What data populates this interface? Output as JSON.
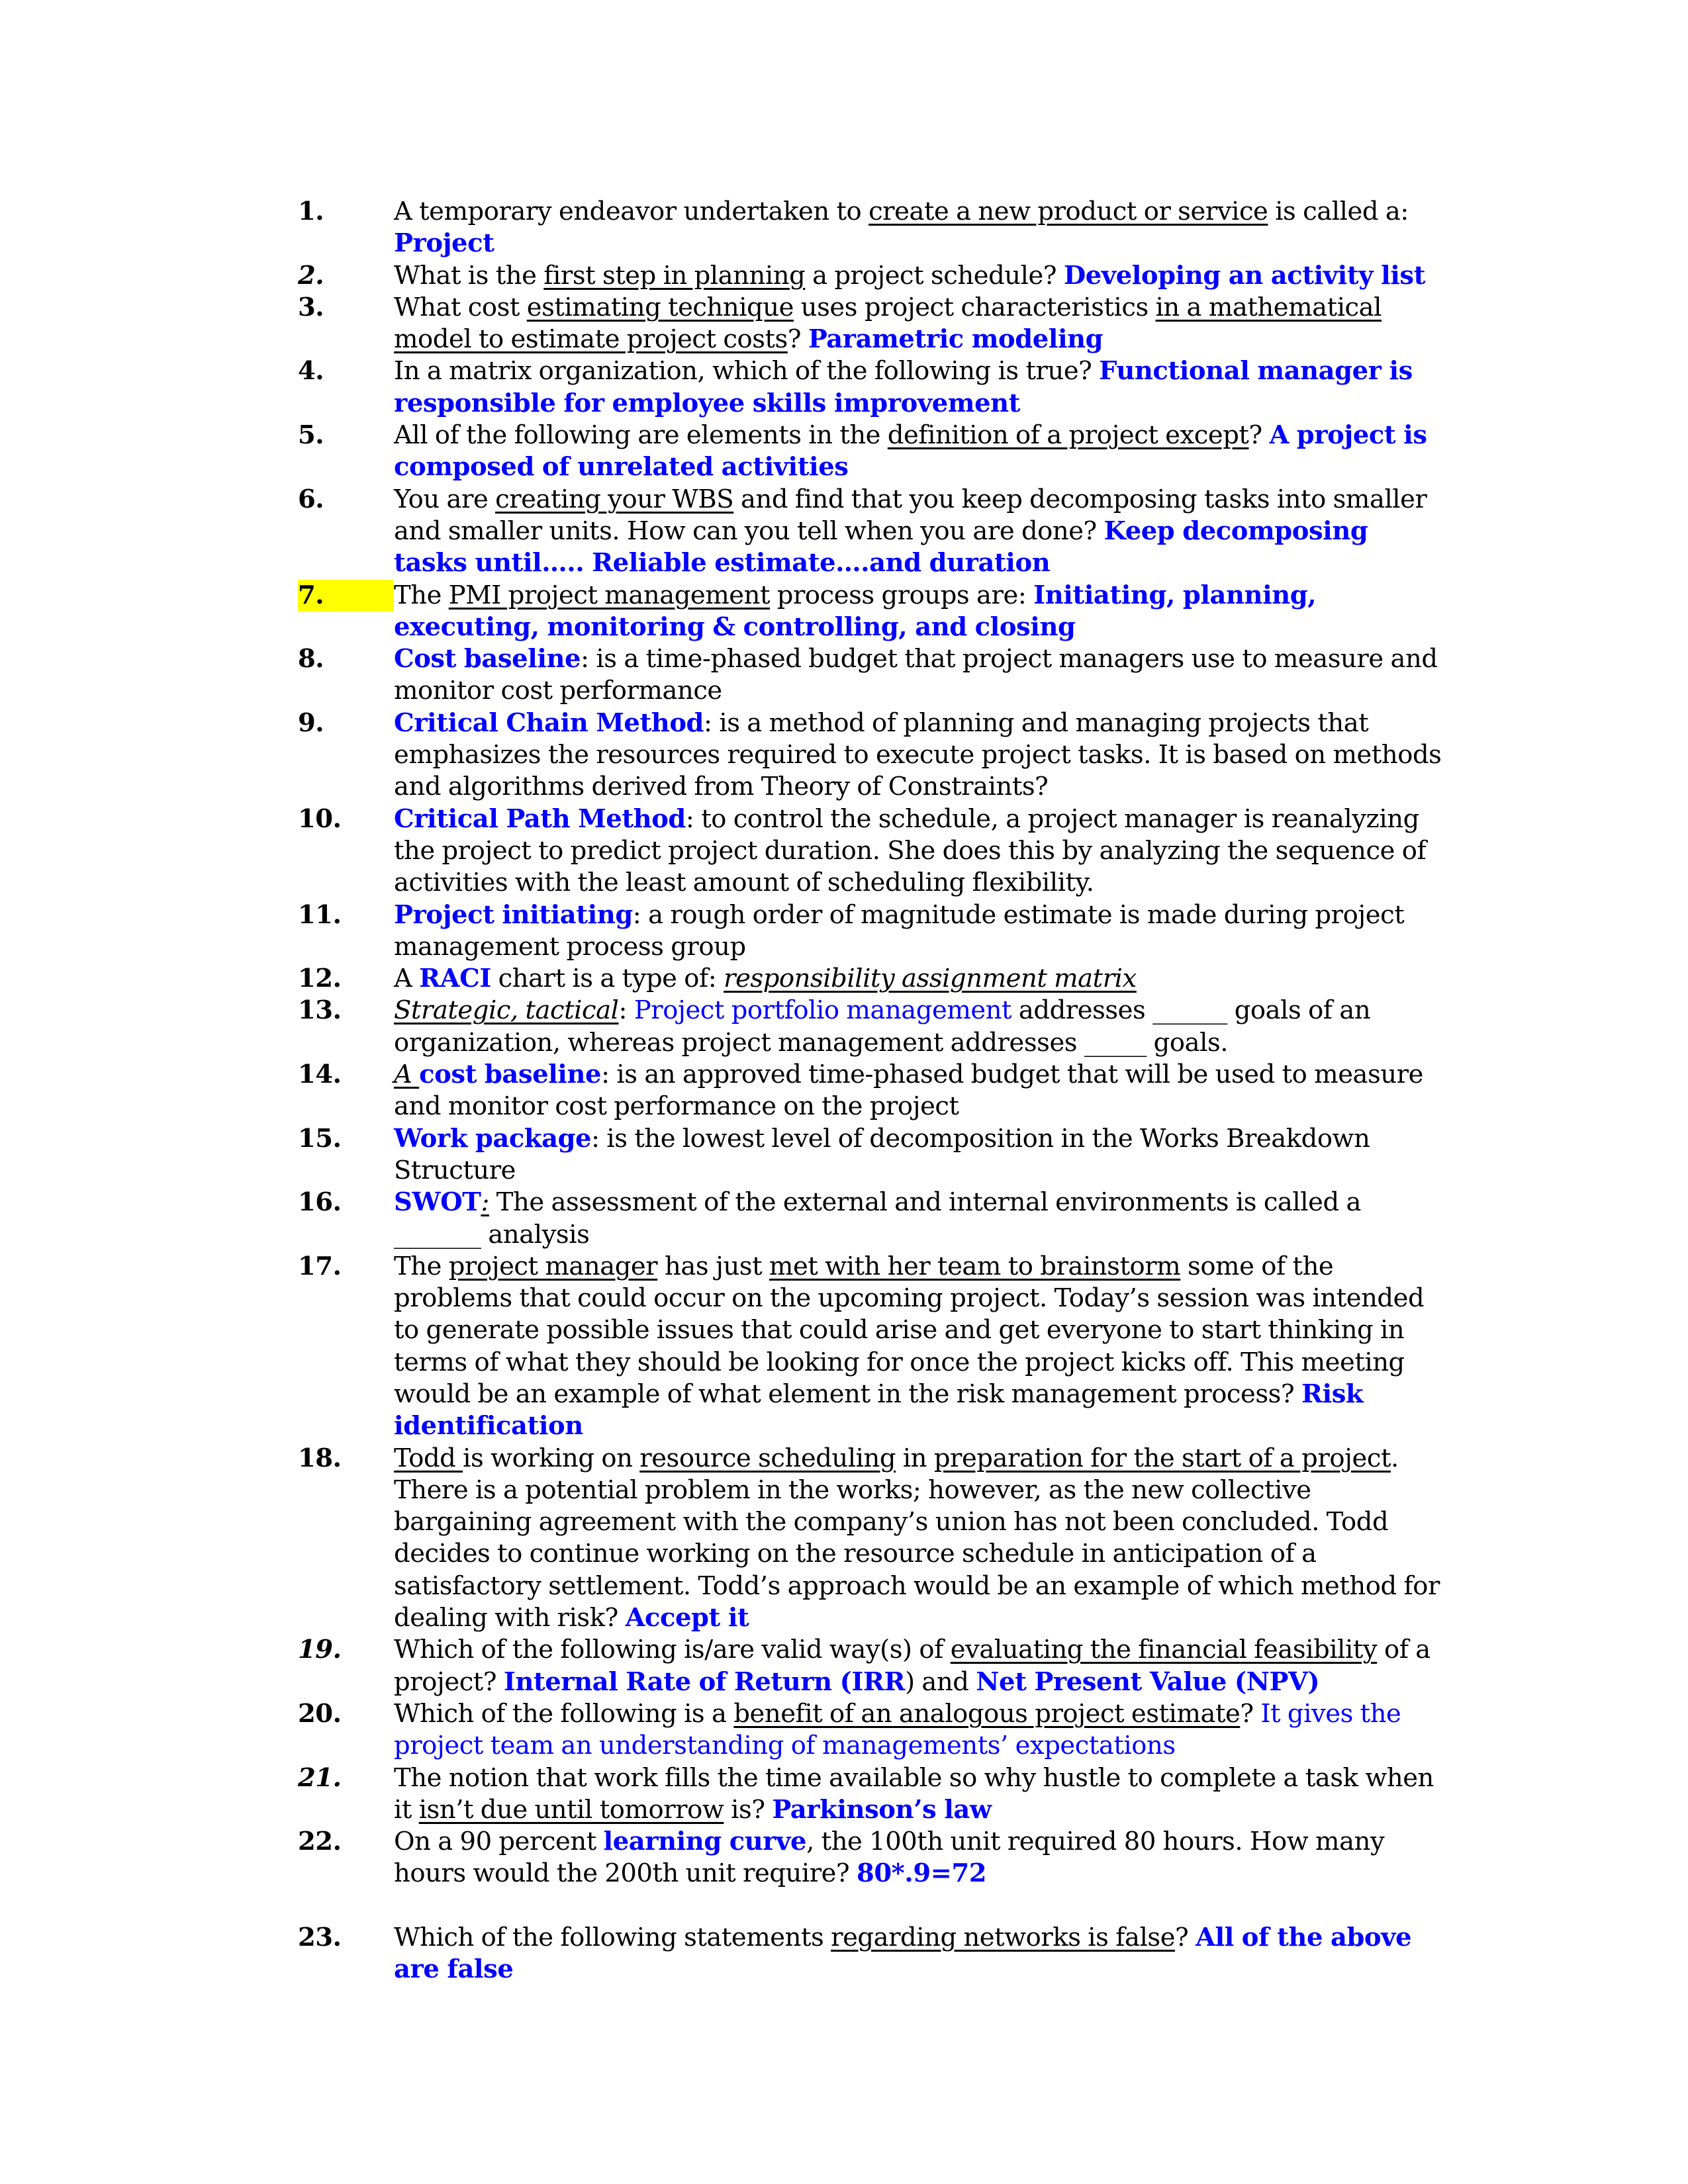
{
  "document": {
    "accent_color": "#0000ff",
    "highlight_color": "#ffff00",
    "questions": [
      {
        "number": "1.",
        "number_italic": false,
        "highlighted": false,
        "runs": [
          {
            "text": "A temporary endeavor undertaken to "
          },
          {
            "text": "create a new product or service",
            "u": true
          },
          {
            "text": " is called a: "
          },
          {
            "text": "Project",
            "b": true,
            "blue": true
          }
        ]
      },
      {
        "number": "2.",
        "number_italic": true,
        "highlighted": false,
        "runs": [
          {
            "text": "What is the "
          },
          {
            "text": "first step in planning",
            "u": true
          },
          {
            "text": " a project schedule? "
          },
          {
            "text": "Developing an activity list",
            "b": true,
            "blue": true
          }
        ]
      },
      {
        "number": "3.",
        "number_italic": false,
        "highlighted": false,
        "runs": [
          {
            "text": "What cost "
          },
          {
            "text": "estimating technique",
            "u": true
          },
          {
            "text": " uses project characteristics "
          },
          {
            "text": "in a mathematical model to estimate project costs",
            "u": true
          },
          {
            "text": "? "
          },
          {
            "text": "Parametric modeling",
            "b": true,
            "blue": true
          }
        ]
      },
      {
        "number": "4.",
        "number_italic": false,
        "highlighted": false,
        "runs": [
          {
            "text": "In a matrix organization, which of the following is true?  "
          },
          {
            "text": "Functional manager is responsible for employee skills improvement",
            "b": true,
            "blue": true
          }
        ]
      },
      {
        "number": "5.",
        "number_italic": false,
        "highlighted": false,
        "runs": [
          {
            "text": "All of the following are elements in the "
          },
          {
            "text": "definition of a project except",
            "u": true
          },
          {
            "text": "? "
          },
          {
            "text": "A project is composed of unrelated activities",
            "b": true,
            "blue": true
          }
        ]
      },
      {
        "number": "6.",
        "number_italic": false,
        "highlighted": false,
        "runs": [
          {
            "text": "You are "
          },
          {
            "text": "creating your WBS",
            "u": true
          },
          {
            "text": " and find that you keep decomposing tasks into smaller and smaller units. How can you tell when you are done? "
          },
          {
            "text": "Keep decomposing tasks until….. Reliable estimate….and duration",
            "b": true,
            "blue": true
          }
        ]
      },
      {
        "number": "7.",
        "number_italic": false,
        "highlighted": true,
        "runs": [
          {
            "text": "The "
          },
          {
            "text": "PMI project management",
            "u": true
          },
          {
            "text": " process groups are: "
          },
          {
            "text": "Initiating, planning, executing, monitoring & controlling, and closing",
            "b": true,
            "blue": true
          }
        ]
      },
      {
        "number": "8.",
        "number_italic": false,
        "highlighted": false,
        "runs": [
          {
            "text": "Cost baseline",
            "b": true,
            "blue": true
          },
          {
            "text": ": is a time-phased budget that project managers use to measure and monitor cost performance"
          }
        ]
      },
      {
        "number": "9.",
        "number_italic": false,
        "highlighted": false,
        "runs": [
          {
            "text": "Critical Chain Method",
            "b": true,
            "blue": true
          },
          {
            "text": ": is a method of planning and managing projects that emphasizes the resources required to execute project tasks. It is based on methods and algorithms derived from Theory of Constraints?"
          }
        ]
      },
      {
        "number": "10.",
        "number_italic": false,
        "highlighted": false,
        "runs": [
          {
            "text": "Critical Path Method",
            "b": true,
            "blue": true
          },
          {
            "text": ": to control the schedule, a project manager is reanalyzing the project to predict project duration. She does this by analyzing the sequence of activities with the least amount of scheduling flexibility."
          }
        ]
      },
      {
        "number": "11.",
        "number_italic": false,
        "highlighted": false,
        "runs": [
          {
            "text": "Project initiating",
            "b": true,
            "blue": true
          },
          {
            "text": ": a rough order of magnitude estimate is made during project management process group"
          }
        ]
      },
      {
        "number": "12.",
        "number_italic": false,
        "highlighted": false,
        "runs": [
          {
            "text": "A "
          },
          {
            "text": "RACI",
            "b": true,
            "blue": true
          },
          {
            "text": " chart is a type of: "
          },
          {
            "text": "responsibility assignment matrix",
            "i": true,
            "u": true
          }
        ]
      },
      {
        "number": "13.",
        "number_italic": false,
        "highlighted": false,
        "runs": [
          {
            "text": "Strategic, tactical",
            "i": true,
            "u": true
          },
          {
            "text": ": "
          },
          {
            "text": "Project portfolio management",
            "blue": true
          },
          {
            "text": " addresses ______ goals of an organization, whereas project management addresses _____ goals."
          }
        ]
      },
      {
        "number": "14.",
        "number_italic": false,
        "highlighted": false,
        "runs": [
          {
            "text": "A ",
            "i": true,
            "u": true
          },
          {
            "text": "cost baseline",
            "b": true,
            "blue": true
          },
          {
            "text": ": is an approved time-phased budget that will be used to measure and monitor cost performance on the project"
          }
        ]
      },
      {
        "number": "15.",
        "number_italic": false,
        "highlighted": false,
        "runs": [
          {
            "text": "Work package",
            "b": true,
            "blue": true
          },
          {
            "text": ": is the lowest level of decomposition in the Works Breakdown Structure"
          }
        ]
      },
      {
        "number": "16.",
        "number_italic": false,
        "highlighted": false,
        "runs": [
          {
            "text": "SWOT",
            "b": true,
            "blue": true
          },
          {
            "text": ":",
            "i": true,
            "u": true
          },
          {
            "text": " The assessment of the external and internal environments is called a _______ analysis"
          }
        ]
      },
      {
        "number": "17.",
        "number_italic": false,
        "highlighted": false,
        "runs": [
          {
            "text": "The "
          },
          {
            "text": "project manager",
            "u": true
          },
          {
            "text": " has just "
          },
          {
            "text": "met with her team to brainstorm",
            "u": true
          },
          {
            "text": " some of the problems that could occur on the upcoming project. Today’s session was intended to generate possible issues that could arise and get everyone to start thinking in terms of what they should be looking for once the project kicks off. This meeting would be an example of what element in the risk management process?  "
          },
          {
            "text": "Risk identification",
            "b": true,
            "blue": true
          }
        ]
      },
      {
        "number": "18.",
        "number_italic": false,
        "highlighted": false,
        "runs": [
          {
            "text": "Todd ",
            "u": true
          },
          {
            "text": "is working on "
          },
          {
            "text": "resource scheduling",
            "u": true
          },
          {
            "text": " in "
          },
          {
            "text": "preparation for the start of a project",
            "u": true
          },
          {
            "text": ". There is a potential problem in the works; however, as the new collective bargaining agreement with the company’s union has not been concluded. Todd decides to continue working on the resource schedule in anticipation of a satisfactory settlement. Todd’s approach would be an example of which method for dealing with risk? "
          },
          {
            "text": "Accept it",
            "b": true,
            "blue": true
          }
        ]
      },
      {
        "number": "19.",
        "number_italic": true,
        "highlighted": false,
        "runs": [
          {
            "text": "Which of the following is/are valid way(s) of "
          },
          {
            "text": "evaluating the financial feasibility",
            "u": true
          },
          {
            "text": " of a project?  "
          },
          {
            "text": "Internal Rate of Return (IRR",
            "b": true,
            "blue": true
          },
          {
            "text": ") and "
          },
          {
            "text": "Net Present Value (NPV)",
            "b": true,
            "blue": true
          }
        ]
      },
      {
        "number": "20.",
        "number_italic": false,
        "highlighted": false,
        "runs": [
          {
            "text": "Which of the following is a "
          },
          {
            "text": "benefit of an analogous project estimate",
            "u": true
          },
          {
            "text": "? "
          },
          {
            "text": "It gives the project team an understanding of managements’ expectations",
            "blue": true
          }
        ]
      },
      {
        "number": "21.",
        "number_italic": true,
        "highlighted": false,
        "runs": [
          {
            "text": "The notion that work fills the time available so why hustle to complete a task when it "
          },
          {
            "text": "isn’t due until tomorrow",
            "u": true
          },
          {
            "text": " is? "
          },
          {
            "text": "Parkinson’s law",
            "b": true,
            "blue": true
          }
        ]
      },
      {
        "number": "22.",
        "number_italic": false,
        "highlighted": false,
        "runs": [
          {
            "text": "On a 90 percent "
          },
          {
            "text": "learning curve",
            "b": true,
            "blue": true
          },
          {
            "text": ", the 100th unit required 80 hours. How many hours would the 200th unit require? "
          },
          {
            "text": "80*.9=72",
            "b": true,
            "blue": true
          }
        ]
      },
      {
        "number": "23.",
        "number_italic": false,
        "highlighted": false,
        "gap_before": true,
        "runs": [
          {
            "text": "Which of the following statements "
          },
          {
            "text": "regarding networks is false",
            "u": true
          },
          {
            "text": "? "
          },
          {
            "text": "All of the above are false",
            "b": true,
            "blue": true
          }
        ]
      }
    ]
  }
}
